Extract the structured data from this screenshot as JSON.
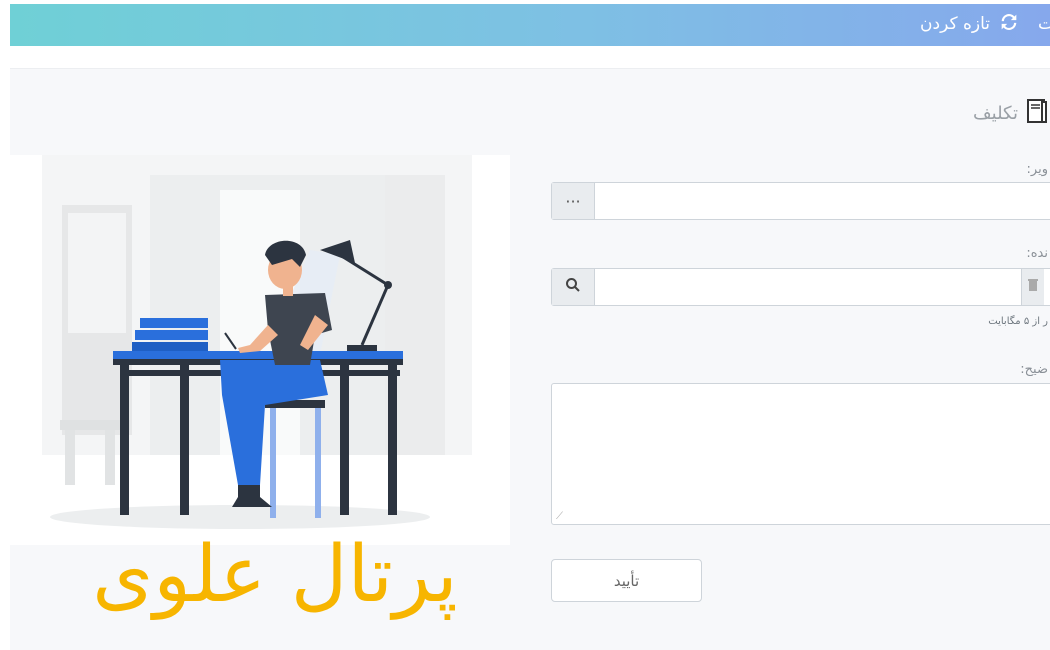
{
  "topbar": {
    "refresh_label": "تازه کردن",
    "cut_text": "ت",
    "refresh_icon": "refresh-icon"
  },
  "card": {
    "title": "تکلیف",
    "title_icon": "assignment-book-icon"
  },
  "form": {
    "field1_label": "ویر:",
    "field1_button": "···",
    "field2_label": "نده:",
    "field2_search_icon": "search-icon",
    "field2_delete_icon": "trash-icon",
    "field2_hint": "ر از ۵ مگابایت",
    "field3_label": "ضیح:",
    "submit_label": "تأیید"
  },
  "watermark": {
    "text": "پرتال علوی"
  },
  "colors": {
    "topbar_start": "#6fd0d6",
    "topbar_end": "#86a8ec",
    "watermark": "#f7b500",
    "illustration_blue": "#2a6fdc"
  }
}
